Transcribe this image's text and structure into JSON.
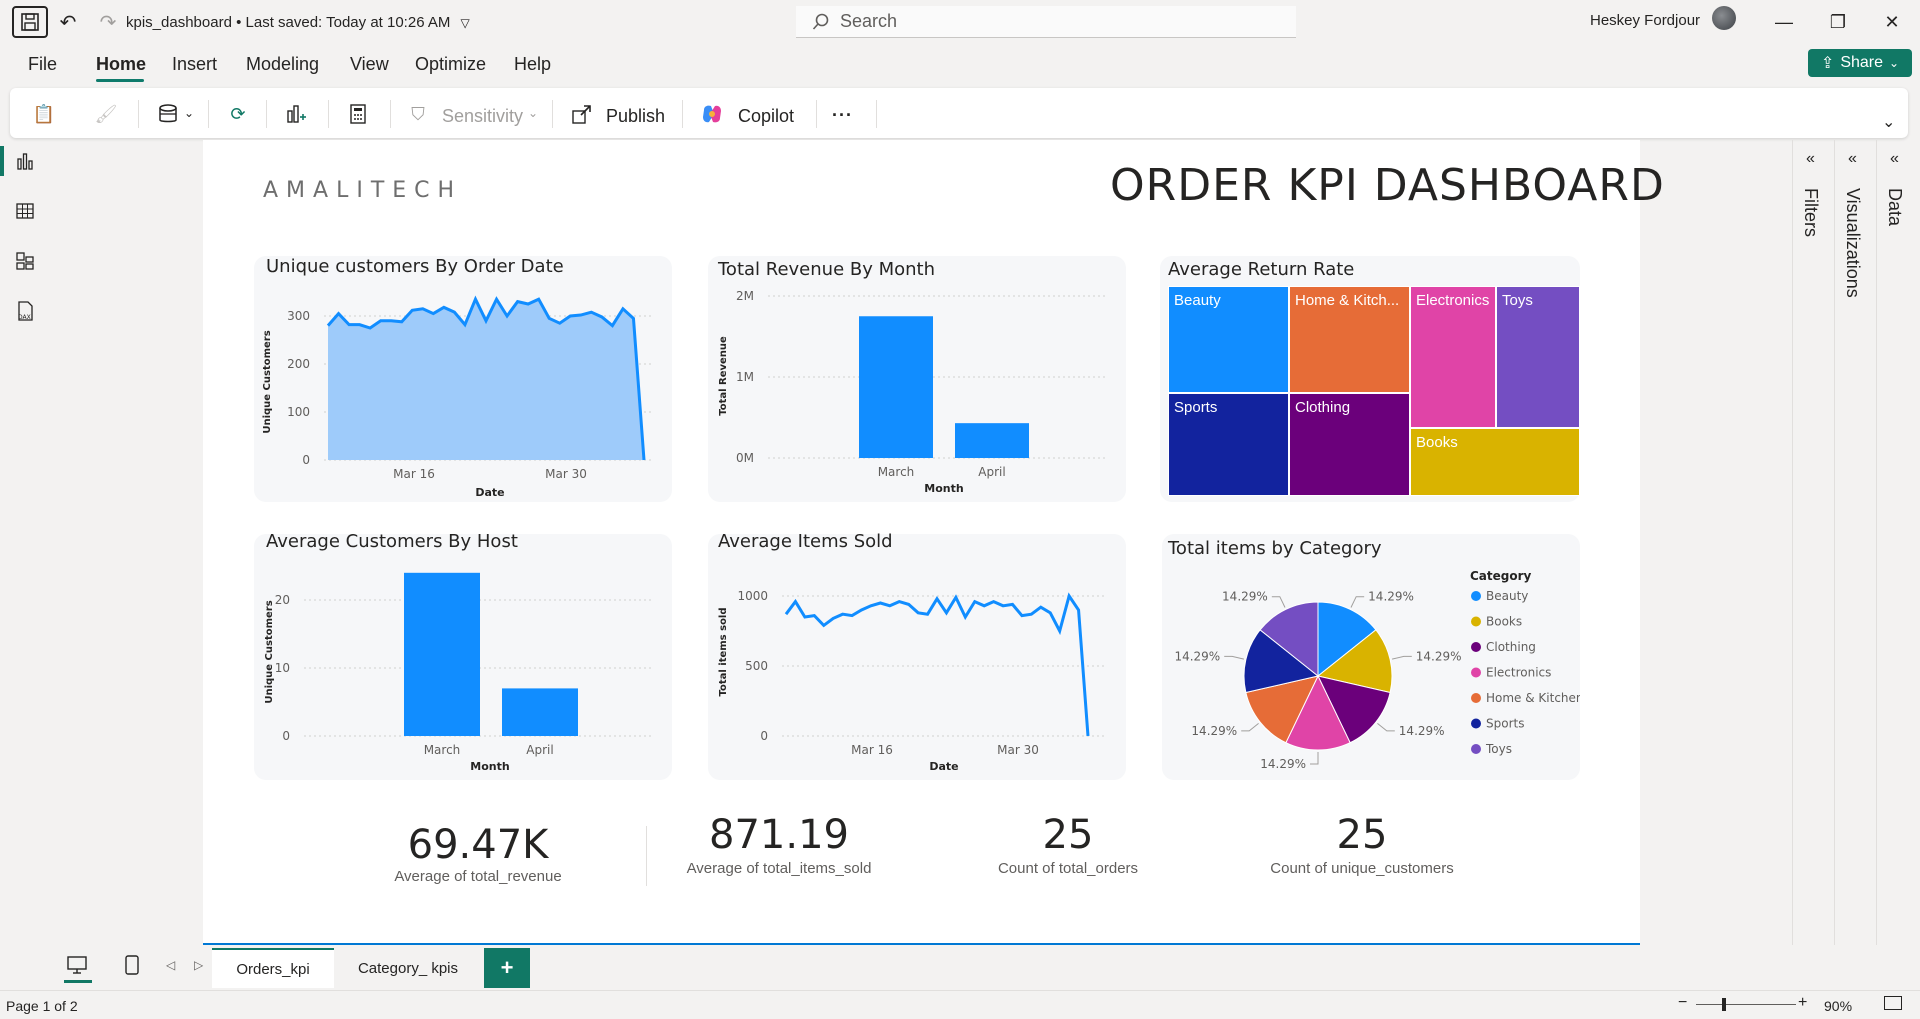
{
  "titlebar": {
    "file_name": "kpis_dashboard",
    "saved_status": "Last saved: Today at 10:26 AM",
    "search_placeholder": "Search",
    "user_name": "Heskey Fordjour"
  },
  "menu": {
    "items": [
      "File",
      "Home",
      "Insert",
      "Modeling",
      "View",
      "Optimize",
      "Help"
    ],
    "active": "Home",
    "share_label": "Share"
  },
  "ribbon": {
    "sensitivity_label": "Sensitivity",
    "publish_label": "Publish",
    "copilot_label": "Copilot",
    "more_label": "..."
  },
  "report": {
    "logo_text": "AMALITECH",
    "title": "ORDER KPI DASHBOARD"
  },
  "colors": {
    "accent": "#117865",
    "bar_blue": "#118DFF",
    "area_fill": "#9ECBFA",
    "card_bg": "#F6F7F9"
  },
  "kpis": [
    {
      "value": "69.47K",
      "label": "Average of total_revenue"
    },
    {
      "value": "871.19",
      "label": "Average of total_items_sold"
    },
    {
      "value": "25",
      "label": "Count of total_orders"
    },
    {
      "value": "25",
      "label": "Count of unique_customers"
    }
  ],
  "chart_data": [
    {
      "type": "area",
      "title": "Unique customers By Order Date",
      "xlabel": "Date",
      "ylabel": "Unique Customers",
      "ylim": [
        0,
        300
      ],
      "y_ticks": [
        "0",
        "100",
        "200",
        "300"
      ],
      "x_ticks": [
        "Mar 16",
        "Mar 30"
      ],
      "values": [
        280,
        305,
        282,
        282,
        275,
        290,
        290,
        288,
        312,
        315,
        305,
        318,
        308,
        282,
        335,
        290,
        335,
        300,
        330,
        325,
        335,
        295,
        285,
        300,
        302,
        308,
        298,
        280,
        315,
        295,
        0
      ]
    },
    {
      "type": "bar",
      "title": "Total Revenue By Month",
      "xlabel": "Month",
      "ylabel": "Total Revenue",
      "ylim": [
        0,
        2000000
      ],
      "y_ticks": [
        "0M",
        "1M",
        "2M"
      ],
      "categories": [
        "March",
        "April"
      ],
      "values": [
        1750000,
        430000
      ]
    },
    {
      "type": "treemap",
      "title": "Average Return Rate",
      "categories": [
        "Beauty",
        "Home & Kitch...",
        "Electronics",
        "Toys",
        "Sports",
        "Clothing",
        "Books"
      ],
      "colors": [
        "#118DFF",
        "#E66C37",
        "#E044A7",
        "#744EC2",
        "#12239E",
        "#6B007B",
        "#D9B300"
      ]
    },
    {
      "type": "bar",
      "title": "Average Customers By Host",
      "xlabel": "Month",
      "ylabel": "Unique Customers",
      "ylim": [
        0,
        25
      ],
      "y_ticks": [
        "0",
        "10",
        "20"
      ],
      "categories": [
        "March",
        "April"
      ],
      "values": [
        24,
        7
      ]
    },
    {
      "type": "line",
      "title": "Average Items Sold",
      "xlabel": "Date",
      "ylabel": "Total items sold",
      "ylim": [
        0,
        1000
      ],
      "y_ticks": [
        "0",
        "500",
        "1000"
      ],
      "x_ticks": [
        "Mar 16",
        "Mar 30"
      ],
      "values": [
        870,
        960,
        850,
        860,
        790,
        840,
        870,
        860,
        900,
        930,
        950,
        930,
        960,
        940,
        880,
        870,
        980,
        880,
        990,
        850,
        960,
        930,
        960,
        930,
        940,
        860,
        870,
        920,
        880,
        750,
        1000,
        900,
        0
      ]
    },
    {
      "type": "pie",
      "title": "Total items by Category",
      "legend_title": "Category",
      "categories": [
        "Beauty",
        "Books",
        "Clothing",
        "Electronics",
        "Home & Kitchen",
        "Sports",
        "Toys"
      ],
      "values": [
        14.29,
        14.29,
        14.29,
        14.29,
        14.29,
        14.29,
        14.29
      ],
      "labels": [
        "14.29%",
        "14.29%",
        "14.29%",
        "14.29%",
        "14.29%",
        "14.29%",
        "14.29%"
      ],
      "colors": [
        "#118DFF",
        "#D9B300",
        "#6B007B",
        "#E044A7",
        "#E66C37",
        "#12239E",
        "#744EC2"
      ],
      "legend_position": "right"
    }
  ],
  "panes": {
    "filters": "Filters",
    "visualizations": "Visualizations",
    "data": "Data"
  },
  "tabs": [
    {
      "label": "Orders_kpi",
      "active": true
    },
    {
      "label": "Category_ kpis",
      "active": false
    }
  ],
  "add_tab_label": "+",
  "status": {
    "page": "Page 1 of 2",
    "zoom": "90%"
  }
}
